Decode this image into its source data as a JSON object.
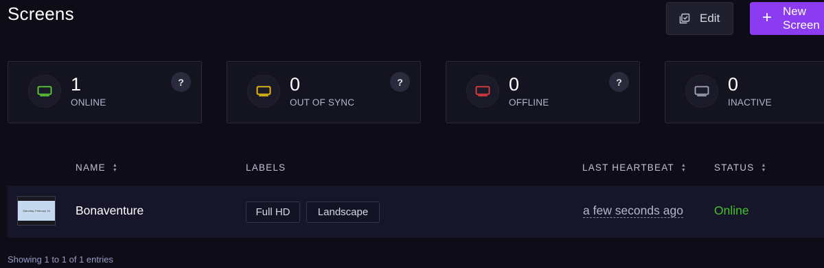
{
  "header": {
    "title": "Screens",
    "edit_label": "Edit",
    "new_label": "New Screen"
  },
  "summary_cards": [
    {
      "count": "1",
      "label": "ONLINE",
      "color": "#5fd236",
      "help": "?"
    },
    {
      "count": "0",
      "label": "OUT OF SYNC",
      "color": "#f2c80f",
      "help": "?"
    },
    {
      "count": "0",
      "label": "OFFLINE",
      "color": "#e83b3b",
      "help": "?"
    },
    {
      "count": "0",
      "label": "INACTIVE",
      "color": "#a9a9b9",
      "help": "?"
    }
  ],
  "table": {
    "columns": [
      "NAME",
      "LABELS",
      "LAST HEARTBEAT",
      "STATUS"
    ],
    "rows": [
      {
        "name": "Bonaventure",
        "thumbnail_text": "Saturday, February 18",
        "labels": [
          "Full HD",
          "Landscape"
        ],
        "last_heartbeat": "a few seconds ago",
        "status": "Online",
        "status_color": "#44c22b"
      }
    ]
  },
  "footer": {
    "info": "Showing 1 to 1 of 1 entries"
  },
  "colors": {
    "accent": "#8b3cf0",
    "background": "#0d0c17",
    "card_bg": "#141320"
  }
}
